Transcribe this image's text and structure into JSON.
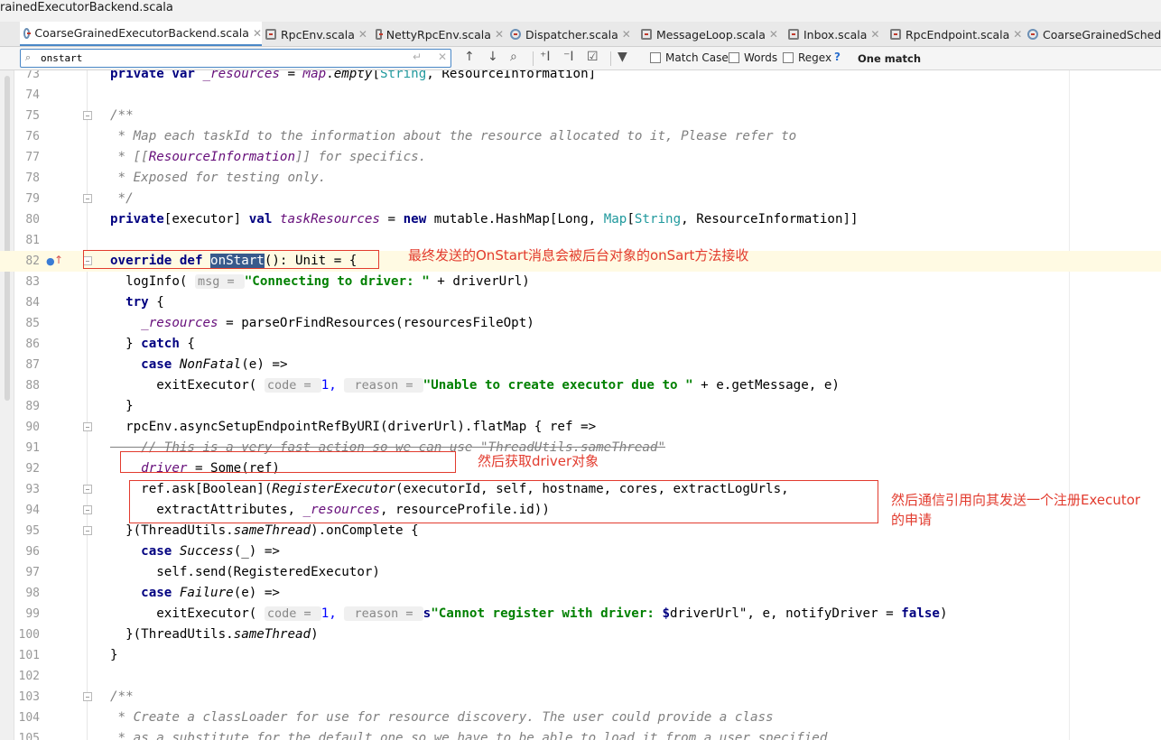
{
  "window": {
    "title": "rainedExecutorBackend.scala"
  },
  "tabs": [
    {
      "label": "CoarseGrainedExecutorBackend.scala",
      "active": true,
      "icon": "scala-class-icon"
    },
    {
      "label": "RpcEnv.scala",
      "active": false,
      "icon": "scala-file-icon"
    },
    {
      "label": "NettyRpcEnv.scala",
      "active": false,
      "icon": "scala-file-icon"
    },
    {
      "label": "Dispatcher.scala",
      "active": false,
      "icon": "scala-class-icon"
    },
    {
      "label": "MessageLoop.scala",
      "active": false,
      "icon": "scala-file-icon"
    },
    {
      "label": "Inbox.scala",
      "active": false,
      "icon": "scala-file-icon"
    },
    {
      "label": "RpcEndpoint.scala",
      "active": false,
      "icon": "scala-file-icon"
    },
    {
      "label": "CoarseGrainedSchedu",
      "active": false,
      "icon": "scala-class-icon"
    }
  ],
  "find": {
    "query": "onstart",
    "options": [
      "Match Case",
      "Words",
      "Regex"
    ],
    "help": "?",
    "result": "One match"
  },
  "editor": {
    "line_numbers": [
      "73",
      "74",
      "75",
      "76",
      "77",
      "78",
      "79",
      "80",
      "81",
      "82",
      "83",
      "84",
      "85",
      "86",
      "87",
      "88",
      "89",
      "90",
      "91",
      "92",
      "93",
      "94",
      "95",
      "96",
      "97",
      "98",
      "99",
      "100",
      "101",
      "102",
      "103",
      "104",
      "105"
    ],
    "current_line": "82",
    "lines": {
      "l73": [
        "private var ",
        "_resources",
        " = ",
        "Map",
        ".",
        "empty",
        "[",
        "String",
        ", ResourceInformation]"
      ],
      "l75": "/**",
      "l76": " * Map each taskId to the information about the resource allocated to it, Please refer to",
      "l77": [
        " * [[",
        "ResourceInformation",
        "]] for specifics."
      ],
      "l78": " * Exposed for testing only.",
      "l79": " */",
      "l80": [
        "private",
        "[executor] ",
        "val ",
        "taskResources",
        " = ",
        "new ",
        "mutable.HashMap[Long, ",
        "Map",
        "[",
        "String",
        ", ResourceInformation]]"
      ],
      "l82": [
        "override def ",
        "onStart",
        "(): Unit = {"
      ],
      "l83": [
        "  logInfo( ",
        "msg = ",
        "\"Connecting to driver: \"",
        " + driverUrl)"
      ],
      "l84": [
        "  ",
        "try",
        " {"
      ],
      "l85": [
        "    ",
        "_resources",
        " = parseOrFindResources(resourcesFileOpt)"
      ],
      "l86": [
        "  } ",
        "catch",
        " {"
      ],
      "l87": [
        "    ",
        "case ",
        "NonFatal",
        "(e) =>"
      ],
      "l88": [
        "      exitExecutor( ",
        "code = ",
        "1, ",
        " reason = ",
        "\"Unable to create executor due to \"",
        " + e.getMessage, e)"
      ],
      "l89": "  }",
      "l90": [
        "  rpcEnv.asyncSetupEndpointRefByURI(driverUrl).flatMap { ref =>"
      ],
      "l91": "    // This is a very fast action so we can use \"ThreadUtils.sameThread\"",
      "l92": [
        "    ",
        "driver",
        " = Some(ref)"
      ],
      "l93": [
        "    ref.ask[Boolean](",
        "RegisterExecutor",
        "(executorId, self, hostname, cores, extractLogUrls,"
      ],
      "l94": [
        "      extractAttributes, ",
        "_resources",
        ", resourceProfile.id))"
      ],
      "l95": [
        "  }(ThreadUtils.",
        "sameThread",
        ").onComplete {"
      ],
      "l96": [
        "    ",
        "case ",
        "Success",
        "(_) =>"
      ],
      "l97": "      self.send(RegisteredExecutor)",
      "l98": [
        "    ",
        "case ",
        "Failure",
        "(e) =>"
      ],
      "l99": [
        "      exitExecutor( ",
        "code = ",
        "1, ",
        " reason = ",
        "s",
        "\"Cannot register with driver: ",
        "$",
        "driverUrl\"",
        ", e, notifyDriver = ",
        "false",
        ")"
      ],
      "l100": [
        "  }(ThreadUtils.",
        "sameThread",
        ")"
      ],
      "l101": "}",
      "l103": "/**",
      "l104": " * Create a classLoader for use for resource discovery. The user could provide a class",
      "l105": " * as a substitute for the default one so we have to be able to load it from a user specified"
    }
  },
  "annotations": {
    "note1": "最终发送的OnStart消息会被后台对象的onSart方法接收",
    "note2": "然后获取driver对象",
    "note3_line1": "然后通信引用向其发送一个注册Executor",
    "note3_line2": "的申请"
  },
  "colors": {
    "keyword": "#000080",
    "comment": "#808080",
    "string": "#008000",
    "field": "#660e7a",
    "annotation_red": "#e23b2e",
    "search_hit": "#385a8c",
    "current_line": "#fffae3",
    "accent": "#4a88c7"
  }
}
